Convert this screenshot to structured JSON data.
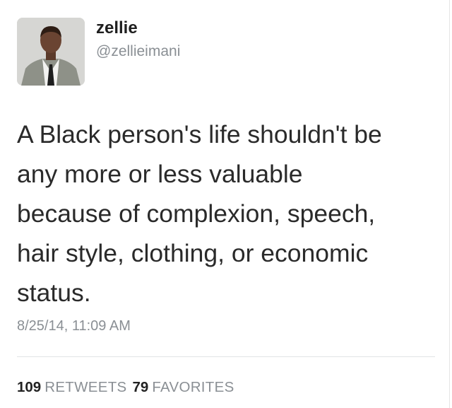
{
  "user": {
    "display_name": "zellie",
    "handle": "@zellieimani"
  },
  "tweet": {
    "text_lines": [
      "A Black person's life shouldn't be",
      "any more or less valuable",
      "because of complexion, speech,",
      "hair style, clothing, or economic",
      "status."
    ],
    "timestamp": "8/25/14, 11:09 AM"
  },
  "stats": {
    "retweets_count": "109",
    "retweets_label": "RETWEETS",
    "favorites_count": "79",
    "favorites_label": "FAVORITES"
  }
}
